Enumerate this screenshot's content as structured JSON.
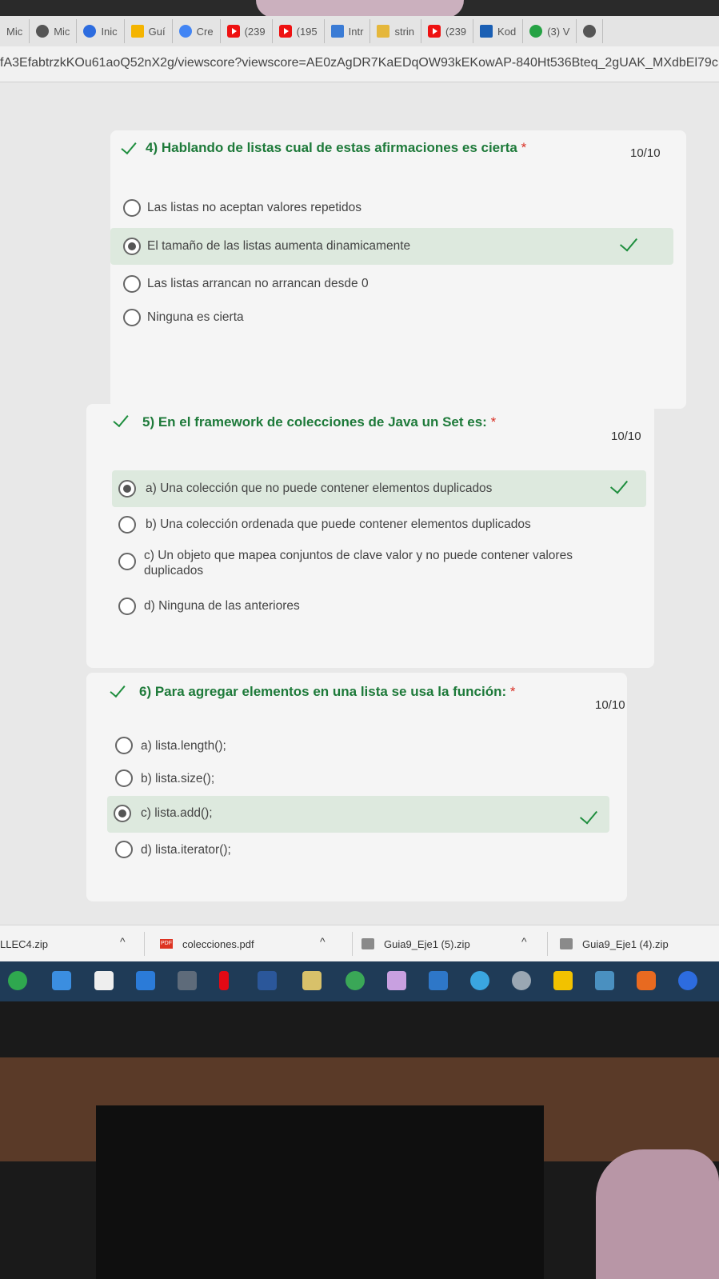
{
  "browser": {
    "tabs": [
      {
        "label": "Mic",
        "icon": "none"
      },
      {
        "label": "Mic",
        "icon": "globe-icon"
      },
      {
        "label": "Inic",
        "icon": "zoom-icon"
      },
      {
        "label": "Guí",
        "icon": "drive-icon"
      },
      {
        "label": "Cre",
        "icon": "google-icon"
      },
      {
        "label": "(239",
        "icon": "youtube-icon"
      },
      {
        "label": "(195",
        "icon": "youtube-icon"
      },
      {
        "label": "Intr",
        "icon": "arc-icon"
      },
      {
        "label": "strin",
        "icon": "folder-icon"
      },
      {
        "label": "(239",
        "icon": "youtube-icon"
      },
      {
        "label": "Kod",
        "icon": "kodland-icon"
      },
      {
        "label": "(3) V",
        "icon": "whatsapp-icon"
      }
    ],
    "url": "fA3EfabtrzkKOu61aoQ52nX2g/viewscore?viewscore=AE0zAgDR7KaEDqOW93kEKowAP-840Ht536Bteq_2gUAK_MXdbEl79cF"
  },
  "questions": [
    {
      "title": "4) Hablando de listas cual de estas afirmaciones es cierta",
      "required_mark": "*",
      "score": "10/10",
      "options": [
        "Las listas no aceptan valores repetidos",
        "El tamaño de las listas aumenta dinamicamente",
        "Las listas arrancan no arrancan desde 0",
        "Ninguna es cierta"
      ],
      "selected_index": 1
    },
    {
      "title": "5) En el framework de colecciones de Java un Set es:",
      "required_mark": "*",
      "score": "10/10",
      "options": [
        "a) Una colección que no puede contener elementos duplicados",
        "b) Una colección ordenada que puede contener elementos duplicados",
        "c) Un objeto que mapea conjuntos de clave valor y no puede contener valores duplicados",
        "d) Ninguna de las anteriores"
      ],
      "selected_index": 0
    },
    {
      "title": "6) Para agregar elementos en una lista se usa la función:",
      "required_mark": "*",
      "score": "10/10",
      "options": [
        "a) lista.length();",
        "b) lista.size();",
        "c) lista.add();",
        "d) lista.iterator();"
      ],
      "selected_index": 2
    }
  ],
  "downloads": [
    {
      "name": "LLEC4.zip"
    },
    {
      "name": "colecciones.pdf",
      "badge": "PDF"
    },
    {
      "name": "Guia9_Eje1 (5).zip"
    },
    {
      "name": "Guia9_Eje1 (4).zip"
    }
  ],
  "taskbar": {
    "icons": [
      "edge-icon",
      "mail-icon",
      "amazon-icon",
      "store-icon",
      "calculator-icon",
      "netflix-icon",
      "word-icon",
      "notepad-icon",
      "chrome-icon",
      "paint-icon",
      "photos-icon",
      "ie-icon",
      "settings-icon",
      "warning-icon",
      "monitor-icon",
      "office-icon",
      "zoom-icon"
    ]
  },
  "colors": {
    "correct": "#1e8e3e",
    "required": "#d93025",
    "selected_bg": "#dde9de"
  }
}
